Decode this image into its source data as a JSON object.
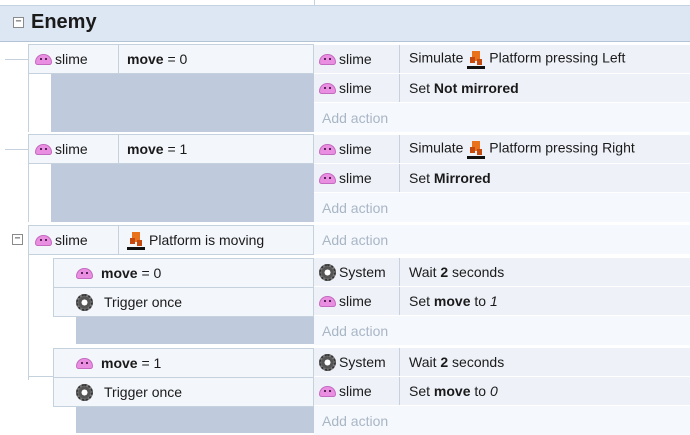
{
  "group": {
    "title": "Enemy"
  },
  "events": [
    {
      "object": "slime",
      "cond_var": "move",
      "cond_op": " = 0",
      "actions": [
        {
          "object": "slime",
          "pre": "Simulate ",
          "bold": "",
          "post": "Platform pressing Left",
          "icon": "platform-behavior-icon"
        },
        {
          "object": "slime",
          "pre": "Set ",
          "bold": "Not mirrored",
          "post": ""
        }
      ],
      "add_action": "Add action"
    },
    {
      "object": "slime",
      "cond_var": "move",
      "cond_op": " = 1",
      "actions": [
        {
          "object": "slime",
          "pre": "Simulate ",
          "bold": "",
          "post": "Platform pressing Right",
          "icon": "platform-behavior-icon"
        },
        {
          "object": "slime",
          "pre": "Set ",
          "bold": "Mirrored",
          "post": ""
        }
      ],
      "add_action": "Add action"
    },
    {
      "object": "slime",
      "cond_text": "Platform is moving",
      "add_action": "Add action",
      "subevents": [
        {
          "cond_var": "move",
          "cond_op": " = 0",
          "trigger": "Trigger once",
          "actions": [
            {
              "object": "System",
              "pre": "Wait ",
              "bold": "2",
              "post": " seconds"
            },
            {
              "object": "slime",
              "pre": "Set ",
              "bold": "move",
              "post": " to ",
              "italic": "1"
            }
          ],
          "add_action": "Add action"
        },
        {
          "cond_var": "move",
          "cond_op": " = 1",
          "trigger": "Trigger once",
          "actions": [
            {
              "object": "System",
              "pre": "Wait ",
              "bold": "2",
              "post": " seconds"
            },
            {
              "object": "slime",
              "pre": "Set ",
              "bold": "move",
              "post": " to ",
              "italic": "0"
            }
          ],
          "add_action": "Add action"
        }
      ]
    }
  ]
}
